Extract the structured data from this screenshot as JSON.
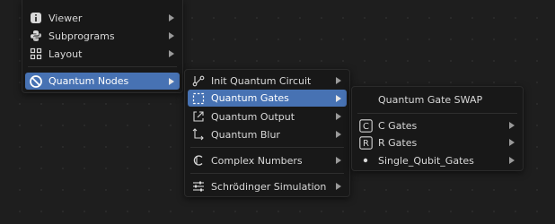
{
  "menu_main": {
    "items": [
      {
        "label": "Viewer",
        "icon": "viewer-icon"
      },
      {
        "label": "Subprograms",
        "icon": "python-icon"
      },
      {
        "label": "Layout",
        "icon": "layout-grid-icon"
      },
      {
        "label": "Quantum Nodes",
        "icon": "quantum-nodes-icon"
      }
    ]
  },
  "menu_quantum": {
    "items": [
      {
        "label": "Init Quantum Circuit",
        "icon": "init-circuit-icon"
      },
      {
        "label": "Quantum Gates",
        "icon": "selection-box-icon"
      },
      {
        "label": "Quantum Output",
        "icon": "output-icon"
      },
      {
        "label": "Quantum Blur",
        "icon": "blur-icon"
      },
      {
        "label": "Complex Numbers",
        "icon": "complex-c-icon"
      },
      {
        "label": "Schrödinger Simulation",
        "icon": "sliders-icon"
      }
    ]
  },
  "menu_gates": {
    "items": [
      {
        "label": "Quantum Gate SWAP",
        "icon": ""
      },
      {
        "label": "C Gates",
        "icon": "boxed-c-icon",
        "glyph": "C"
      },
      {
        "label": "R Gates",
        "icon": "boxed-r-icon",
        "glyph": "R"
      },
      {
        "label": "Single_Qubit_Gates",
        "icon": "dot-icon"
      }
    ]
  },
  "colors": {
    "active": "#4772b3",
    "menu_bg": "#181818",
    "text": "#d8d8d8"
  }
}
